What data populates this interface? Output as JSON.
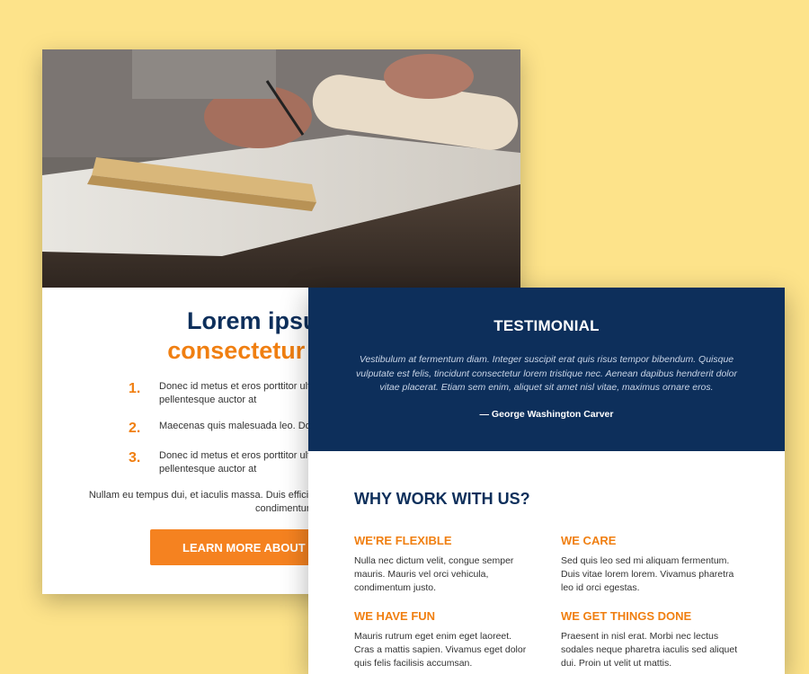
{
  "back_card": {
    "title_line1": "Lorem ipsum do",
    "title_line2": "consectetur adipisc",
    "steps": [
      {
        "number": "1.",
        "text": "Donec id metus et eros porttitor ulti amet massa pellentesque auctor at"
      },
      {
        "number": "2.",
        "text": "Maecenas quis malesuada leo. Done"
      },
      {
        "number": "3.",
        "text": "Donec id metus et eros porttitor ulti amet massa pellentesque auctor at"
      }
    ],
    "body_text": "Nullam eu tempus dui, et iaculis massa. Duis efficitur t malesuada orci, at tincidunt mauris condimentum",
    "cta_label": "LEARN MORE ABOUT C"
  },
  "front_card": {
    "testimonial": {
      "heading": "TESTIMONIAL",
      "quote": "Vestibulum at fermentum diam. Integer suscipit erat quis risus tempor bibendum. Quisque vulputate est felis, tincidunt consectetur lorem tristique nec. Aenean dapibus hendrerit dolor vitae placerat. Etiam sem enim, aliquet sit amet nisl vitae, maximus ornare eros.",
      "author": "— George Washington Carver"
    },
    "why_heading": "WHY WORK WITH US?",
    "features": [
      {
        "title": "WE'RE FLEXIBLE",
        "text": "Nulla nec dictum velit, congue semper mauris. Mauris vel orci vehicula, condimentum justo."
      },
      {
        "title": "WE CARE",
        "text": "Sed quis leo sed mi aliquam fermentum. Duis vitae lorem lorem. Vivamus pharetra leo id orci egestas."
      },
      {
        "title": "WE HAVE FUN",
        "text": "Mauris rutrum eget enim eget laoreet. Cras a mattis sapien. Vivamus eget dolor quis felis facilisis accumsan."
      },
      {
        "title": "WE GET THINGS DONE",
        "text": "Praesent in nisl erat. Morbi nec lectus sodales neque pharetra iaculis sed aliquet dui. Proin ut velit ut mattis."
      }
    ]
  },
  "colors": {
    "background": "#fde38a",
    "navy": "#0d2f5b",
    "orange": "#f07f11",
    "button_orange": "#f58220"
  }
}
